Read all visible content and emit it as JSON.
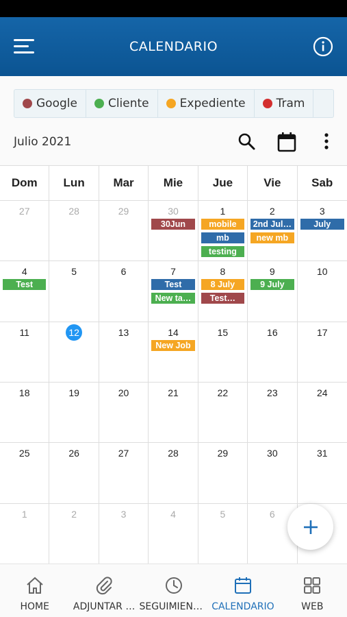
{
  "app_bar": {
    "title": "CALENDARIO"
  },
  "filters": [
    {
      "label": "Google",
      "color": "#a0484b"
    },
    {
      "label": "Cliente",
      "color": "#4caf50"
    },
    {
      "label": "Expediente",
      "color": "#f5a623"
    },
    {
      "label": "Tram",
      "color": "#d32f2f"
    }
  ],
  "month": {
    "label": "Julio  2021"
  },
  "weekdays": [
    "Dom",
    "Lun",
    "Mar",
    "Mie",
    "Jue",
    "Vie",
    "Sab"
  ],
  "colors": {
    "google": "#a0484b",
    "cliente": "#4caf50",
    "expediente": "#f5a623",
    "blue": "#2f6ca9",
    "accent": "#1e6fb8",
    "today": "#2196f3"
  },
  "weeks": [
    [
      {
        "num": "27",
        "other": true,
        "events": []
      },
      {
        "num": "28",
        "other": true,
        "events": []
      },
      {
        "num": "29",
        "other": true,
        "events": []
      },
      {
        "num": "30",
        "other": true,
        "events": [
          {
            "title": "30Jun",
            "color": "#a0484b"
          }
        ]
      },
      {
        "num": "1",
        "events": [
          {
            "title": "mobile",
            "color": "#f5a623"
          },
          {
            "title": "mb",
            "color": "#2f6ca9"
          },
          {
            "title": "testing",
            "color": "#4caf50"
          }
        ]
      },
      {
        "num": "2",
        "events": [
          {
            "title": "2nd Jul…",
            "color": "#2f6ca9"
          },
          {
            "title": "new mb",
            "color": "#f5a623"
          }
        ]
      },
      {
        "num": "3",
        "events": [
          {
            "title": "July",
            "color": "#2f6ca9"
          }
        ]
      }
    ],
    [
      {
        "num": "4",
        "events": [
          {
            "title": "Test",
            "color": "#4caf50"
          }
        ]
      },
      {
        "num": "5",
        "events": []
      },
      {
        "num": "6",
        "events": []
      },
      {
        "num": "7",
        "events": [
          {
            "title": "Test",
            "color": "#2f6ca9"
          },
          {
            "title": "New ta…",
            "color": "#4caf50"
          }
        ]
      },
      {
        "num": "8",
        "events": [
          {
            "title": "8 July",
            "color": "#f5a623"
          },
          {
            "title": "Test…",
            "color": "#a0484b"
          }
        ]
      },
      {
        "num": "9",
        "events": [
          {
            "title": "9 July",
            "color": "#4caf50"
          }
        ]
      },
      {
        "num": "10",
        "events": []
      }
    ],
    [
      {
        "num": "11",
        "events": []
      },
      {
        "num": "12",
        "today": true,
        "events": []
      },
      {
        "num": "13",
        "events": []
      },
      {
        "num": "14",
        "events": [
          {
            "title": "New Job",
            "color": "#f5a623"
          }
        ]
      },
      {
        "num": "15",
        "events": []
      },
      {
        "num": "16",
        "events": []
      },
      {
        "num": "17",
        "events": []
      }
    ],
    [
      {
        "num": "18",
        "events": []
      },
      {
        "num": "19",
        "events": []
      },
      {
        "num": "20",
        "events": []
      },
      {
        "num": "21",
        "events": []
      },
      {
        "num": "22",
        "events": []
      },
      {
        "num": "23",
        "events": []
      },
      {
        "num": "24",
        "events": []
      }
    ],
    [
      {
        "num": "25",
        "events": []
      },
      {
        "num": "26",
        "events": []
      },
      {
        "num": "27",
        "events": []
      },
      {
        "num": "28",
        "events": []
      },
      {
        "num": "29",
        "events": []
      },
      {
        "num": "30",
        "events": []
      },
      {
        "num": "31",
        "events": []
      }
    ],
    [
      {
        "num": "1",
        "other": true,
        "events": []
      },
      {
        "num": "2",
        "other": true,
        "events": []
      },
      {
        "num": "3",
        "other": true,
        "events": []
      },
      {
        "num": "4",
        "other": true,
        "events": []
      },
      {
        "num": "5",
        "other": true,
        "events": []
      },
      {
        "num": "6",
        "other": true,
        "events": []
      },
      {
        "num": "",
        "other": true,
        "events": []
      }
    ]
  ],
  "bottom_nav": [
    {
      "label": "HOME",
      "icon": "home-icon"
    },
    {
      "label": "ADJUNTAR …",
      "icon": "paperclip-icon"
    },
    {
      "label": "SEGUIMIENT…",
      "icon": "clock-icon"
    },
    {
      "label": "CALENDARIO",
      "icon": "calendar-icon",
      "active": true
    },
    {
      "label": "WEB",
      "icon": "grid-icon"
    }
  ]
}
